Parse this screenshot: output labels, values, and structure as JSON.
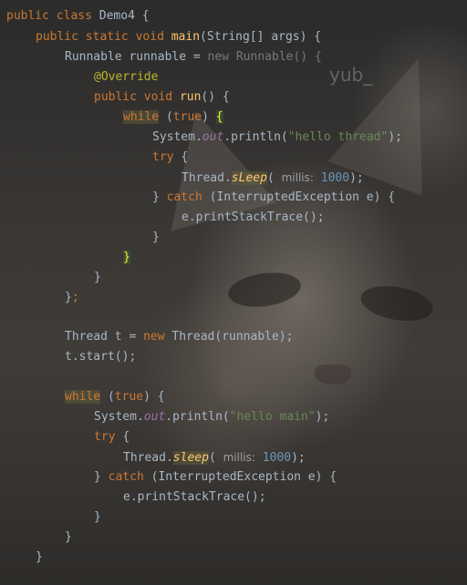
{
  "watermark": "yub_",
  "code": {
    "l1_public": "public",
    "l1_class": "class",
    "l1_name": "Demo4 {",
    "l2_public": "public",
    "l2_static": "static",
    "l2_void": "void",
    "l2_main": "main",
    "l2_args": "(String[] args) {",
    "l3_type": "Runnable runnable = ",
    "l3_new": "new",
    "l3_runnable": "Runnable",
    "l3_end": "() {",
    "l4_ann": "@Override",
    "l5_public": "public",
    "l5_void": "void",
    "l5_run": "run",
    "l5_end": "() {",
    "l6_while": "while",
    "l6_true": "true",
    "l6_brace": "{",
    "l7_sys": "System.",
    "l7_out": "out",
    "l7_println": ".println(",
    "l7_str": "\"hello thread\"",
    "l7_end": ");",
    "l8_try": "try",
    "l8_brace": "{",
    "l9_thread": "Thread.",
    "l9_sleep": "sLeep",
    "l9_paren": "(",
    "l9_hint": "millis:",
    "l9_num": "1000",
    "l9_end": ");",
    "l10_close": "} ",
    "l10_catch": "catch",
    "l10_end": "(InterruptedException e) {",
    "l11_text": "e.printStackTrace();",
    "l12_text": "}",
    "l13_text": "}",
    "l14_text": "}",
    "l15_brace": "}",
    "l15_semi": ";",
    "l16_text": "Thread t = ",
    "l16_new": "new",
    "l16_end": "Thread(runnable);",
    "l17_text": "t.start();",
    "l18_while": "while",
    "l18_true": "true",
    "l18_end": ") {",
    "l19_sys": "System.",
    "l19_out": "out",
    "l19_println": ".println(",
    "l19_str": "\"hello main\"",
    "l19_end": ");",
    "l20_try": "try",
    "l20_brace": "{",
    "l21_thread": "Thread.",
    "l21_sleep": "sleep",
    "l21_paren": "(",
    "l21_hint": "millis:",
    "l21_num": "1000",
    "l21_end": ");",
    "l22_close": "} ",
    "l22_catch": "catch",
    "l22_end": "(InterruptedException e) {",
    "l23_text": "e.printStackTrace();",
    "l24_text": "}",
    "l25_text": "}",
    "l26_text": "}"
  }
}
